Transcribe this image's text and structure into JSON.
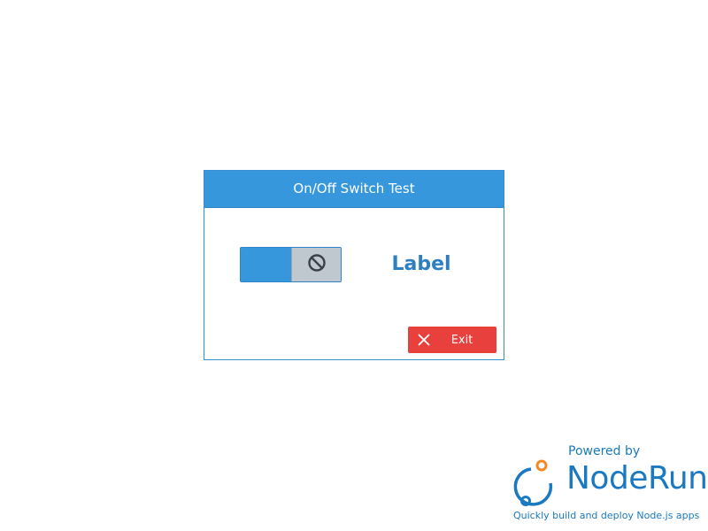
{
  "dialog": {
    "title": "On/Off Switch Test",
    "label": "Label",
    "switch": {
      "state": "on",
      "knob_icon": "ban-icon",
      "on_color": "#3797dc",
      "knob_color": "#bfc7cf"
    },
    "exit_button": {
      "label": "Exit",
      "icon": "close-icon",
      "color": "#e8413d"
    }
  },
  "branding": {
    "powered_by": "Powered by",
    "name": "NodeRun",
    "tagline": "Quickly build and deploy Node.js apps",
    "brand_color": "#1b79c1",
    "logo_accent": "#f08a24"
  },
  "colors": {
    "accent": "#3797dc",
    "label_text": "#2e7fc1"
  }
}
